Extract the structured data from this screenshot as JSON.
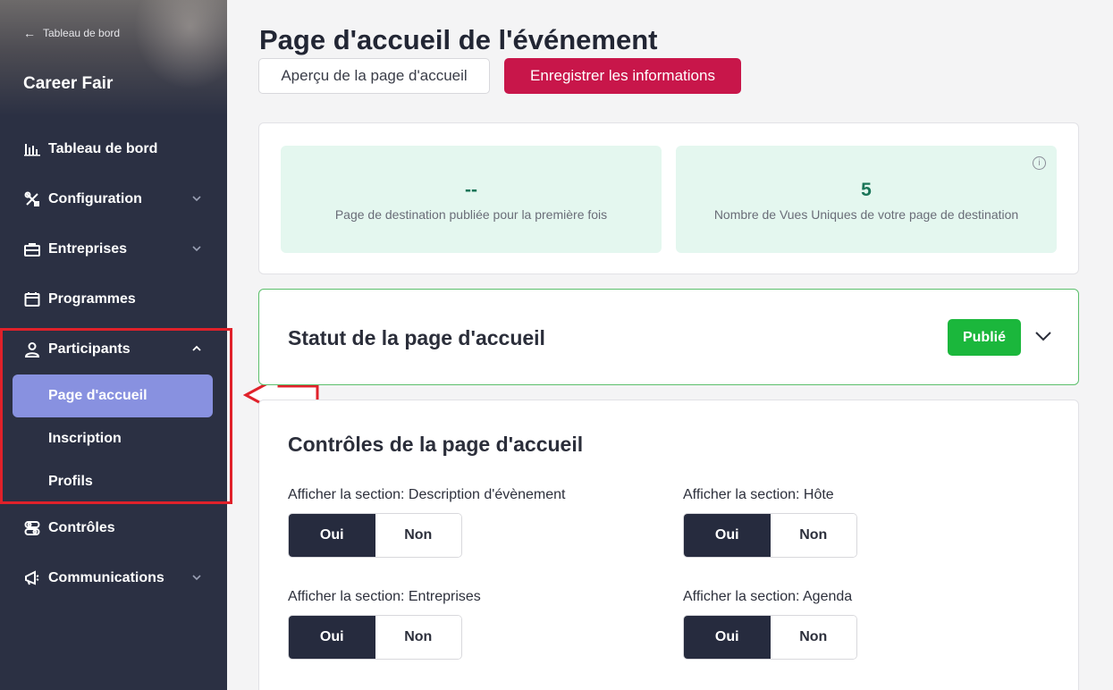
{
  "sidebar": {
    "back_label": "Tableau de bord",
    "event_name": "Career Fair",
    "items": [
      {
        "label": "Tableau de bord"
      },
      {
        "label": "Configuration"
      },
      {
        "label": "Entreprises"
      },
      {
        "label": "Programmes"
      },
      {
        "label": "Participants"
      },
      {
        "label": "Contrôles"
      },
      {
        "label": "Communications"
      }
    ],
    "sub_items": [
      {
        "label": "Page d'accueil"
      },
      {
        "label": "Inscription"
      },
      {
        "label": "Profils"
      }
    ]
  },
  "header": {
    "title": "Page d'accueil de l'événement",
    "preview_button": "Aperçu de la page d'accueil",
    "save_button": "Enregistrer les informations"
  },
  "stats": [
    {
      "value": "--",
      "label": "Page de destination publiée pour la première fois"
    },
    {
      "value": "5",
      "label": "Nombre de Vues Uniques de votre page de destination"
    }
  ],
  "status": {
    "title": "Statut de la page d'accueil",
    "badge": "Publié"
  },
  "controls": {
    "title": "Contrôles de la page d'accueil",
    "yes": "Oui",
    "no": "Non",
    "items": [
      {
        "label": "Afficher la section: Description d'évènement"
      },
      {
        "label": "Afficher la section: Hôte"
      },
      {
        "label": "Afficher la section: Entreprises"
      },
      {
        "label": "Afficher la section: Agenda"
      }
    ]
  },
  "colors": {
    "sidebar_bg": "#2b3043",
    "active_item": "#8891e0",
    "save_button": "#c8164a",
    "published_badge": "#1bb73c",
    "stat_bg": "#e4f7ef",
    "toggle_on": "#262b3e",
    "highlight": "#e0212a"
  }
}
